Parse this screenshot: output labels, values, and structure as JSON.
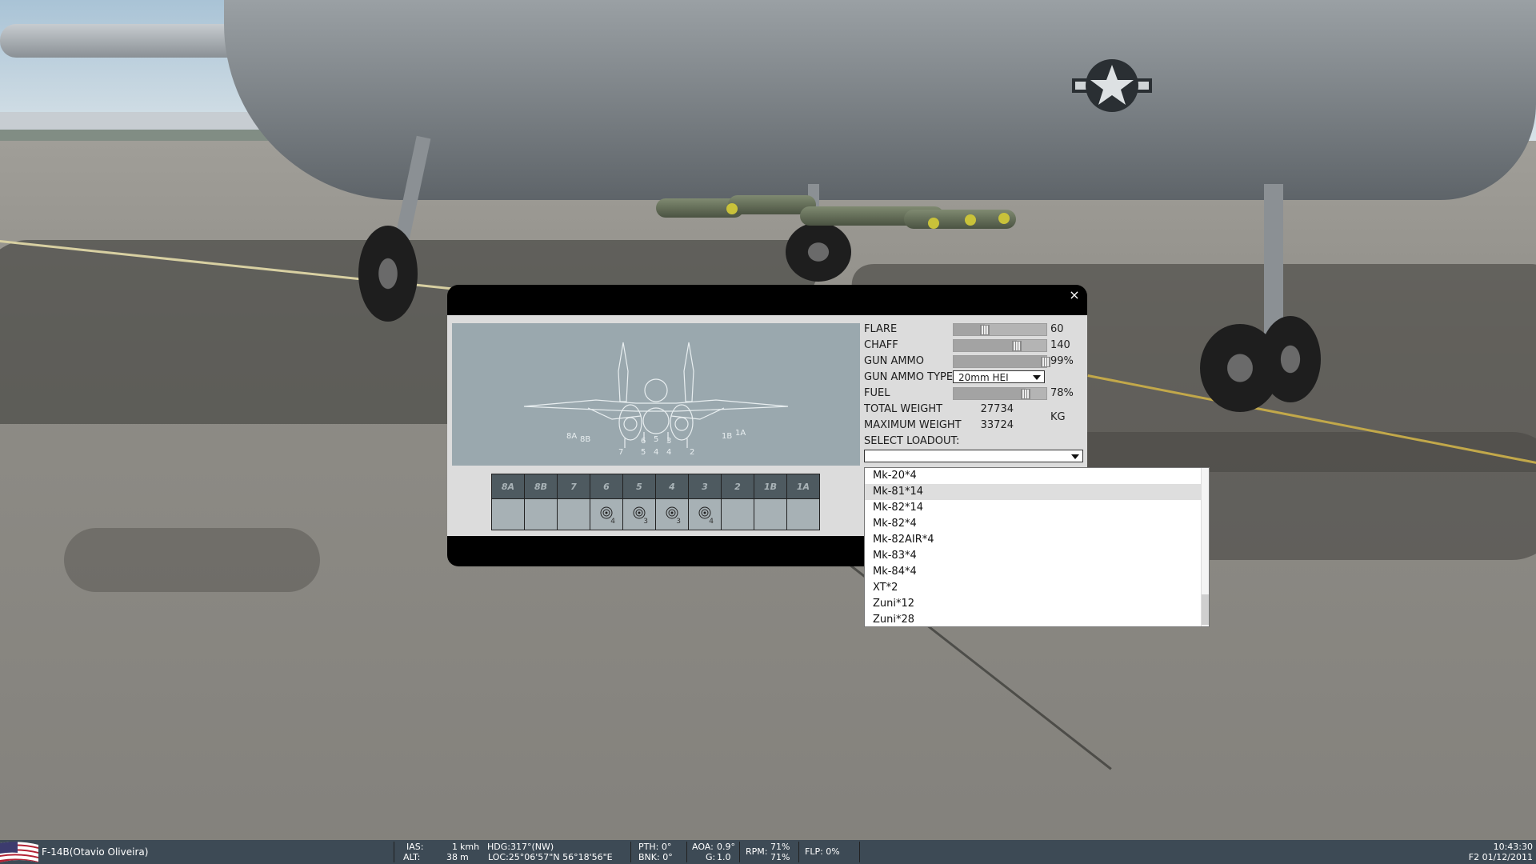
{
  "dialog": {
    "close_icon": "×",
    "stations": {
      "headers": [
        "8A",
        "8B",
        "7",
        "6",
        "5",
        "4",
        "3",
        "2",
        "1B",
        "1A"
      ],
      "counts": [
        "",
        "",
        "",
        "4",
        "3",
        "3",
        "4",
        "",
        "",
        ""
      ]
    },
    "schematic_labels": {
      "left": [
        "8A",
        "8B"
      ],
      "right": [
        "1B",
        "1A"
      ],
      "center_top": [
        "6",
        "5",
        "3"
      ],
      "center_bottom": [
        "7",
        "5",
        "4",
        "4",
        "2"
      ]
    },
    "stores": {
      "flare": {
        "label": "FLARE",
        "value": "60",
        "level": 0.34
      },
      "chaff": {
        "label": "CHAFF",
        "value": "140",
        "level": 0.68
      },
      "gun_ammo": {
        "label": "GUN AMMO",
        "value": "99%",
        "level": 0.99
      },
      "gun_ammo_type": {
        "label": "GUN AMMO TYPE",
        "value": "20mm HEI"
      },
      "fuel": {
        "label": "FUEL",
        "value": "78%",
        "level": 0.78
      },
      "total_weight": {
        "label": "TOTAL WEIGHT",
        "value": "27734"
      },
      "max_weight": {
        "label": "MAXIMUM WEIGHT",
        "value": "33724"
      },
      "weight_unit": "KG",
      "select_loadout": {
        "label": "SELECT LOADOUT:",
        "value": ""
      }
    },
    "loadout_options": [
      "Mk-20*4",
      "Mk-81*14",
      "Mk-82*14",
      "Mk-82*4",
      "Mk-82AIR*4",
      "Mk-83*4",
      "Mk-84*4",
      "XT*2",
      "Zuni*12",
      "Zuni*28"
    ],
    "highlighted_option": "Mk-81*14"
  },
  "statusbar": {
    "aircraft": "F-14B(Otavio Oliveira)",
    "ias_label": "IAS:",
    "ias_value": "1",
    "ias_unit": "kmh",
    "alt_label": "ALT:",
    "alt_value": "38",
    "alt_unit": "m",
    "hdg": "HDG:317°(NW)",
    "loc": "LOC:25°06'57\"N 56°18'56\"E",
    "pth": "PTH: 0°",
    "bnk": "BNK: 0°",
    "aoa_label": "AOA:",
    "aoa_value": "0.9°",
    "g_label": "G:",
    "g_value": "1.0",
    "rpm_label": "RPM:",
    "rpm_1": "71%",
    "rpm_2": "71%",
    "flp": "FLP: 0%",
    "time": "10:43:30",
    "date": "F2 01/12/2011"
  }
}
